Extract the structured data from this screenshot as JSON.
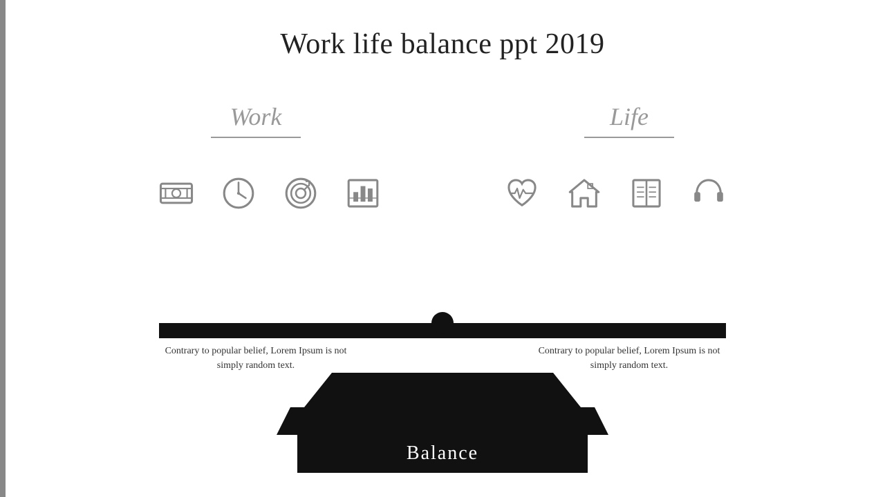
{
  "title": "Work life balance ppt 2019",
  "section_work": {
    "label": "Work",
    "underline": true
  },
  "section_life": {
    "label": "Life",
    "underline": true
  },
  "work_icons": [
    {
      "name": "money-icon",
      "label": "money"
    },
    {
      "name": "clock-icon",
      "label": "clock"
    },
    {
      "name": "target-icon",
      "label": "target"
    },
    {
      "name": "chart-icon",
      "label": "chart"
    }
  ],
  "life_icons": [
    {
      "name": "heart-icon",
      "label": "heart"
    },
    {
      "name": "home-icon",
      "label": "home"
    },
    {
      "name": "book-icon",
      "label": "book"
    },
    {
      "name": "headphones-icon",
      "label": "headphones"
    }
  ],
  "balance_label": "Balance",
  "left_text": "Contrary to popular belief, Lorem Ipsum is not simply random text.",
  "right_text": "Contrary to popular belief, Lorem Ipsum is not simply random text.",
  "colors": {
    "icon_fill": "#888888",
    "beam": "#111111",
    "text": "#333333"
  }
}
